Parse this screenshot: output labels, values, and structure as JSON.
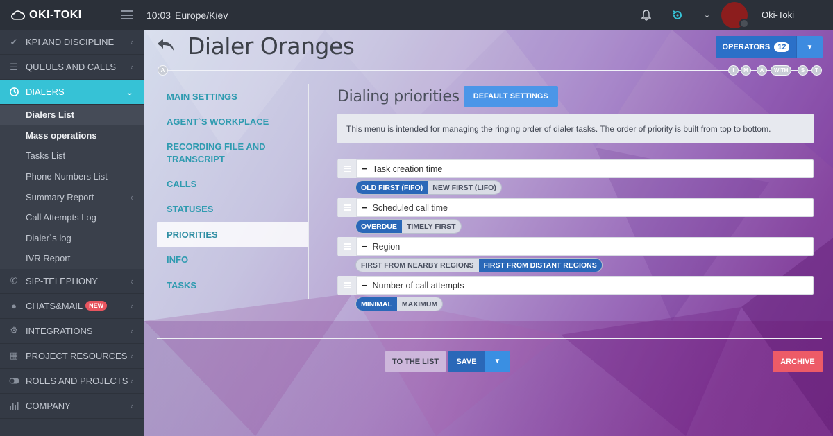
{
  "app": {
    "logo_text": "OKI-TOKI"
  },
  "topbar": {
    "time": "10:03",
    "timezone": "Europe/Kiev",
    "username": "Oki-Toki"
  },
  "sidebar": {
    "items": [
      {
        "label": "KPI AND DISCIPLINE",
        "icon": "check-icon"
      },
      {
        "label": "QUEUES AND CALLS",
        "icon": "list-icon"
      },
      {
        "label": "DIALERS",
        "icon": "clock-icon",
        "active": true
      },
      {
        "label": "SIP-TELEPHONY",
        "icon": "phone-icon"
      },
      {
        "label": "CHATS&MAIL",
        "icon": "chat-icon",
        "badge": "NEW"
      },
      {
        "label": "INTEGRATIONS",
        "icon": "cogs-icon"
      },
      {
        "label": "PROJECT RESOURCES",
        "icon": "grid-icon"
      },
      {
        "label": "ROLES AND PROJECTS",
        "icon": "toggle-icon"
      },
      {
        "label": "COMPANY",
        "icon": "bar-chart-icon"
      }
    ],
    "dialers_sub": [
      {
        "label": "Dialers List"
      },
      {
        "label": "Mass operations"
      },
      {
        "label": "Tasks List"
      },
      {
        "label": "Phone Numbers List"
      },
      {
        "label": "Summary Report"
      },
      {
        "label": "Call Attempts Log"
      },
      {
        "label": "Dialer`s log"
      },
      {
        "label": "IVR Report"
      }
    ]
  },
  "page": {
    "title": "Dialer Oranges",
    "operators_label": "OPERATORS",
    "operators_count": "12",
    "timeline_start": "A",
    "timeline_markers": [
      "I",
      "M",
      "A",
      "WITH",
      "S",
      "T"
    ]
  },
  "tabs": [
    {
      "label": "MAIN SETTINGS"
    },
    {
      "label": "AGENT`S WORKPLACE"
    },
    {
      "label": "RECORDING FILE AND TRANSCRIPT"
    },
    {
      "label": "CALLS"
    },
    {
      "label": "STATUSES"
    },
    {
      "label": "PRIORITIES",
      "active": true
    },
    {
      "label": "INFO"
    },
    {
      "label": "TASKS"
    }
  ],
  "section": {
    "title": "Dialing priorities",
    "default_button": "DEFAULT SETTINGS",
    "info": "This menu is intended for managing the ringing order of dialer tasks. The order of priority is built from top to bottom."
  },
  "priorities": [
    {
      "label": "Task creation time",
      "options": [
        "OLD FIRST (FIFO)",
        "NEW FIRST (LIFO)"
      ],
      "selected": 0
    },
    {
      "label": "Scheduled call time",
      "options": [
        "OVERDUE",
        "TIMELY FIRST"
      ],
      "selected": 0
    },
    {
      "label": "Region",
      "options": [
        "FIRST FROM NEARBY REGIONS",
        "FIRST FROM DISTANT REGIONS"
      ],
      "selected": 1
    },
    {
      "label": "Number of call attempts",
      "options": [
        "MINIMAL",
        "MAXIMUM"
      ],
      "selected": 0
    }
  ],
  "actions": {
    "to_list": "TO THE LIST",
    "save": "SAVE",
    "archive": "ARCHIVE"
  },
  "colors": {
    "accent": "#36c2d6",
    "primary": "#2a68b8",
    "danger": "#ed5b67",
    "sidebar": "#343a45"
  }
}
